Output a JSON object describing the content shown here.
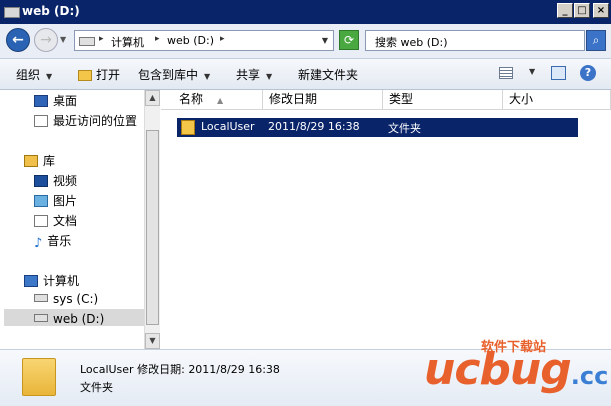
{
  "window": {
    "title": "web (D:)"
  },
  "address": {
    "breadcrumb": [
      "计算机",
      "web (D:)"
    ],
    "search_placeholder": "搜索 web (D:)"
  },
  "toolbar": {
    "organize": "组织",
    "open": "打开",
    "include_in_library": "包含到库中",
    "share": "共享",
    "new_folder": "新建文件夹"
  },
  "nav": {
    "favorites": [
      "桌面",
      "最近访问的位置"
    ],
    "libraries_label": "库",
    "libraries": [
      "视频",
      "图片",
      "文档",
      "音乐"
    ],
    "computer_label": "计算机",
    "drives": [
      "sys (C:)",
      "web (D:)"
    ]
  },
  "columns": [
    "名称",
    "修改日期",
    "类型",
    "大小"
  ],
  "files": [
    {
      "name": "LocalUser",
      "modified": "2011/8/29 16:38",
      "type": "文件夹",
      "size": ""
    }
  ],
  "details": {
    "name": "LocalUser",
    "modified_label": "修改日期:",
    "modified": "2011/8/29 16:38",
    "type": "文件夹"
  },
  "watermark": {
    "small": "软件下载站",
    "big": "ucbug",
    "suffix": ".cc"
  },
  "colors": {
    "titlebar": "#0a246a",
    "selection": "#0a246a",
    "watermark": "#e8612c",
    "watermark_accent": "#3a7fd4"
  }
}
